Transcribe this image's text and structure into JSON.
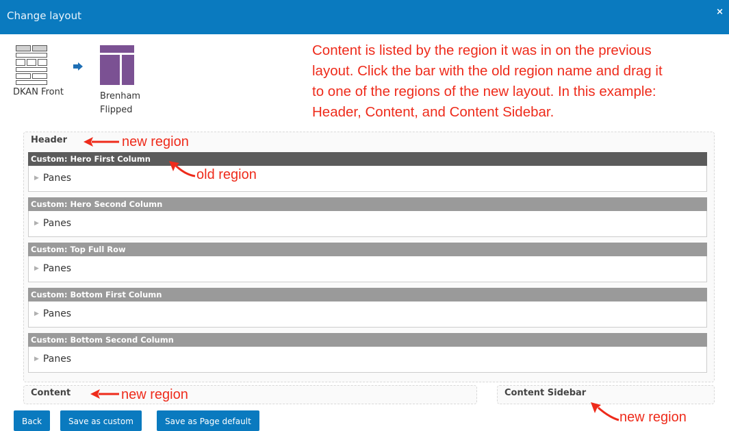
{
  "dialog": {
    "title": "Change layout",
    "close_glyph": "×"
  },
  "layouts": {
    "old_name": "DKAN Front",
    "new_name_line1": "Brenham",
    "new_name_line2": "Flipped"
  },
  "note": "Content is listed by the region it was in on the previous layout. Click the bar with the old region name and drag it to one of the regions of the new layout. In this example: Header, Content, and Content Sidebar.",
  "regions": {
    "header": "Header",
    "content": "Content",
    "content_sidebar": "Content Sidebar"
  },
  "panes": [
    {
      "name": "Custom: Hero First Column",
      "body": "Panes"
    },
    {
      "name": "Custom: Hero Second Column",
      "body": "Panes"
    },
    {
      "name": "Custom: Top Full Row",
      "body": "Panes"
    },
    {
      "name": "Custom: Bottom First Column",
      "body": "Panes"
    },
    {
      "name": "Custom: Bottom Second Column",
      "body": "Panes"
    }
  ],
  "annotations": {
    "new_region": "new region",
    "old_region": "old region"
  },
  "buttons": {
    "back": "Back",
    "save_custom": "Save as custom",
    "save_default": "Save as Page default"
  },
  "colors": {
    "accent": "#0a7abf",
    "annotation": "#ee2b1b",
    "thumbnail": "#7b5193"
  },
  "icons": {
    "close": "close-icon",
    "arrow": "arrow-right-icon",
    "expand": "triangle-right-icon"
  }
}
